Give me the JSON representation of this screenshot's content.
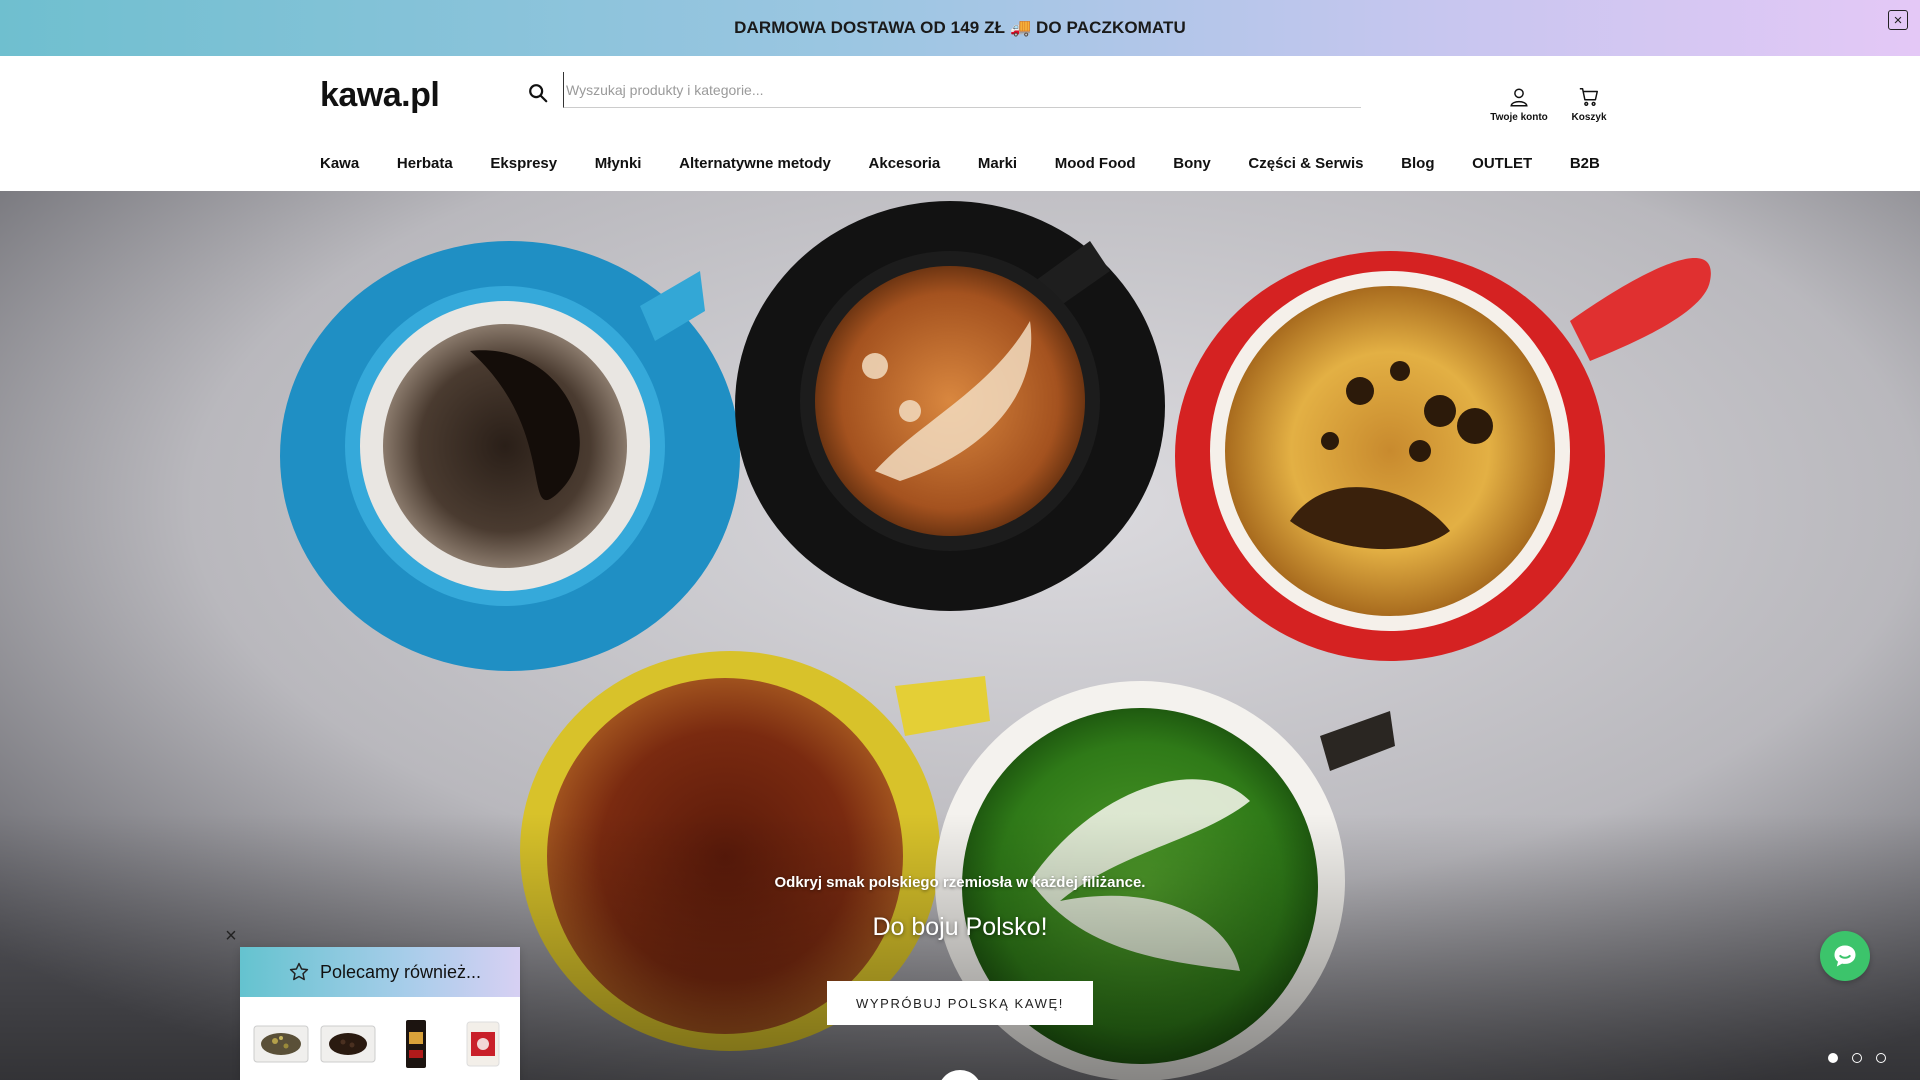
{
  "promo": {
    "text": "DARMOWA DOSTAWA OD 149 ZŁ 🚚 DO PACZKOMATU",
    "close_label": "×"
  },
  "header": {
    "logo": "kawa.pl",
    "search": {
      "placeholder": "Wyszukaj produkty i kategorie...",
      "value": ""
    },
    "account_label": "Twoje konto",
    "cart_label": "Koszyk"
  },
  "nav": {
    "items": [
      "Kawa",
      "Herbata",
      "Ekspresy",
      "Młynki",
      "Alternatywne metody",
      "Akcesoria",
      "Marki",
      "Mood Food",
      "Bony",
      "Części & Serwis",
      "Blog",
      "OUTLET",
      "B2B"
    ]
  },
  "hero": {
    "subtitle": "Odkryj smak polskiego rzemiosła w każdej filiżance.",
    "title": "Do boju Polsko!",
    "cta": "WYPRÓBUJ POLSKĄ KAWĘ!",
    "slides_total": 3,
    "slide_active": 1
  },
  "recommendations": {
    "title": "Polecamy również...",
    "close_label": "×",
    "items": [
      "loose-tea-product",
      "roasted-beans-product",
      "coffee-bag-product",
      "coffee-tin-product"
    ]
  },
  "colors": {
    "chat": "#3cc46b",
    "promo_start": "#6fbfcf",
    "promo_end": "#e4c8f6"
  },
  "icons": {
    "search": "search-icon",
    "account": "user-icon",
    "cart": "cart-icon",
    "chat": "chat-icon",
    "star": "star-icon"
  }
}
